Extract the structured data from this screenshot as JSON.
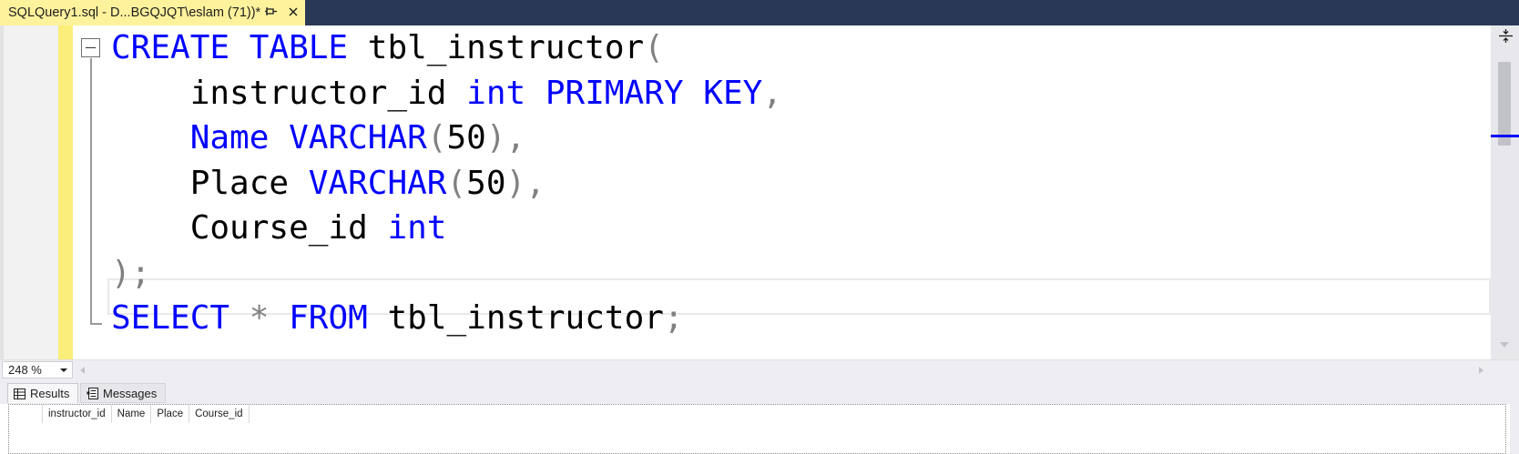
{
  "document_tab": {
    "title": "SQLQuery1.sql - D...BGQJQT\\eslam (71))*",
    "pin_icon": "pin-icon",
    "close_icon": "close-icon"
  },
  "editor": {
    "lines": [
      [
        {
          "t": "kw",
          "v": "CREATE"
        },
        {
          "t": "tx",
          "v": " "
        },
        {
          "t": "kw",
          "v": "TABLE"
        },
        {
          "t": "tx",
          "v": " tbl_instructor"
        },
        {
          "t": "op",
          "v": "("
        }
      ],
      [
        {
          "t": "tx",
          "v": "    instructor_id "
        },
        {
          "t": "kw",
          "v": "int"
        },
        {
          "t": "tx",
          "v": " "
        },
        {
          "t": "kw",
          "v": "PRIMARY"
        },
        {
          "t": "tx",
          "v": " "
        },
        {
          "t": "kw",
          "v": "KEY"
        },
        {
          "t": "op",
          "v": ","
        }
      ],
      [
        {
          "t": "tx",
          "v": "    "
        },
        {
          "t": "kw",
          "v": "Name"
        },
        {
          "t": "tx",
          "v": " "
        },
        {
          "t": "kw",
          "v": "VARCHAR"
        },
        {
          "t": "op",
          "v": "("
        },
        {
          "t": "tx",
          "v": "50"
        },
        {
          "t": "op",
          "v": "),"
        }
      ],
      [
        {
          "t": "tx",
          "v": "    Place "
        },
        {
          "t": "kw",
          "v": "VARCHAR"
        },
        {
          "t": "op",
          "v": "("
        },
        {
          "t": "tx",
          "v": "50"
        },
        {
          "t": "op",
          "v": "),"
        }
      ],
      [
        {
          "t": "tx",
          "v": "    Course_id "
        },
        {
          "t": "kw",
          "v": "int"
        }
      ],
      [
        {
          "t": "op",
          "v": ");"
        }
      ],
      [
        {
          "t": "kw",
          "v": "SELECT"
        },
        {
          "t": "tx",
          "v": " "
        },
        {
          "t": "op",
          "v": "*"
        },
        {
          "t": "tx",
          "v": " "
        },
        {
          "t": "kw",
          "v": "FROM"
        },
        {
          "t": "tx",
          "v": " tbl_instructor"
        },
        {
          "t": "op",
          "v": ";"
        }
      ]
    ],
    "colors": {
      "keyword": "#0000ff",
      "text": "#000000",
      "operator": "#808080",
      "change_bar": "#fbee7a",
      "tab_bar": "#293955",
      "active_tab": "#fff29d"
    }
  },
  "zoom": {
    "value": "248 %"
  },
  "results_tabs": [
    {
      "label": "Results",
      "icon": "grid-icon"
    },
    {
      "label": "Messages",
      "icon": "messages-icon"
    }
  ],
  "results_grid": {
    "columns": [
      "instructor_id",
      "Name",
      "Place",
      "Course_id"
    ]
  }
}
